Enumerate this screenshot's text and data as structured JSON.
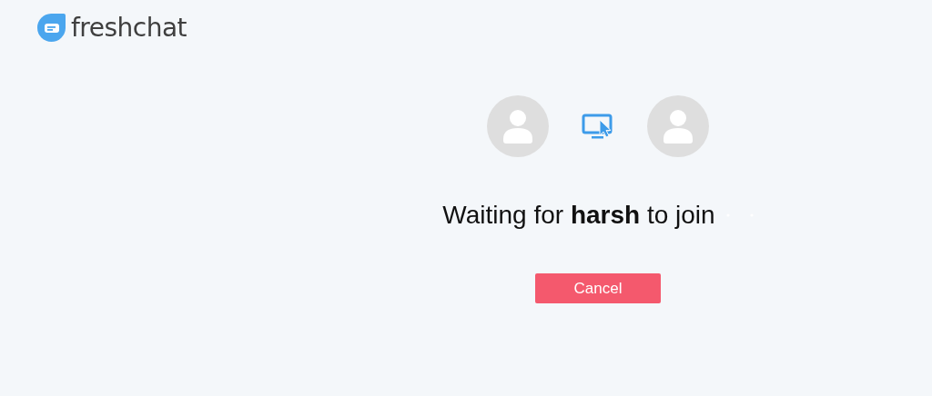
{
  "brand": {
    "name": "freshchat"
  },
  "message": "Waiting for **harsh** to join",
  "buttons": [
    {
      "label": "Cancel"
    }
  ]
}
